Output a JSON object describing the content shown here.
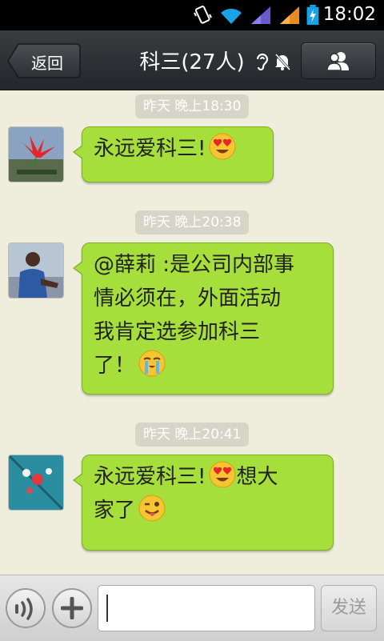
{
  "status_bar": {
    "time": "18:02"
  },
  "header": {
    "back_label": "返回",
    "title": "科三(27人)"
  },
  "messages": [
    {
      "time": "昨天 晚上18:30",
      "lines": [
        "永远爱科三!"
      ],
      "emoji": "heart-eyes"
    },
    {
      "time": "昨天 晚上20:38",
      "lines": [
        "@薛莉 :是公司内部事",
        "情必须在，外面活动",
        "我肯定选参加科三",
        "了！"
      ],
      "emoji": "crying"
    },
    {
      "time": "昨天 晚上20:41",
      "lines": [
        "永远爱科三!",
        "想大",
        "家了"
      ],
      "emoji": "heart-eyes"
    }
  ],
  "input_bar": {
    "send_label": "发送",
    "input_value": ""
  }
}
